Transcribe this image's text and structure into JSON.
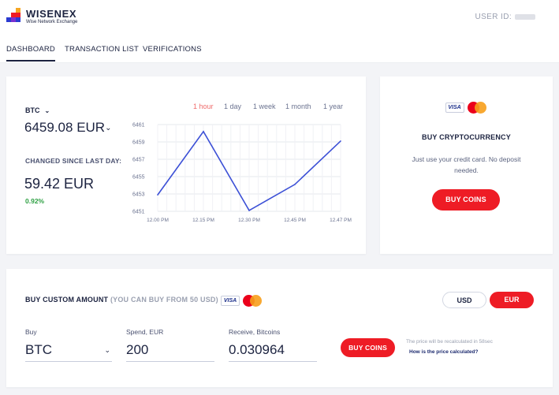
{
  "app": {
    "brand": "WISENEX",
    "brand_sub": "Wise Network Exchange",
    "user_label": "USER ID:"
  },
  "nav": {
    "tabs": [
      {
        "label": "DASHBOARD",
        "active": true
      },
      {
        "label": "TRANSACTION LIST",
        "active": false
      },
      {
        "label": "VERIFICATIONS",
        "active": false
      }
    ]
  },
  "dashboard": {
    "coin": "BTC",
    "price": "6459.08",
    "price_currency": "EUR",
    "changed_label": "CHANGED SINCE LAST DAY:",
    "change_value": "59.42 EUR",
    "change_pct": "0.92%",
    "ranges": [
      {
        "label": "1 hour",
        "active": true
      },
      {
        "label": "1 day",
        "active": false
      },
      {
        "label": "1 week",
        "active": false
      },
      {
        "label": "1 month",
        "active": false
      },
      {
        "label": "1 year",
        "active": false
      }
    ]
  },
  "chart_data": {
    "type": "line",
    "categories": [
      "12.00 PM",
      "12.15 PM",
      "12.30 PM",
      "12.45 PM",
      "12.47 PM"
    ],
    "series": [
      {
        "values": [
          6452.9,
          6460.2,
          6451.1,
          6454.1,
          6459.1
        ]
      }
    ],
    "y_ticks": [
      6461,
      6459,
      6457,
      6455,
      6453,
      6451
    ],
    "ylim": [
      6451,
      6461
    ],
    "grid": true,
    "line_color": "#3c50d6"
  },
  "buy_card": {
    "visa": "VISA",
    "title": "BUY CRYPTOCURRENCY",
    "description": "Just use your credit card. No deposit needed.",
    "button": "BUY COINS"
  },
  "custom": {
    "title": "BUY CUSTOM AMOUNT",
    "subtitle": "(YOU CAN BUY FROM 50 USD)",
    "visa": "VISA",
    "currency_options": [
      {
        "label": "USD",
        "active": false
      },
      {
        "label": "EUR",
        "active": true
      }
    ],
    "buy_label": "Buy",
    "buy_value": "BTC",
    "spend_label": "Spend, EUR",
    "spend_value": "200",
    "receive_label": "Receive, Bitcoins",
    "receive_value": "0.030964",
    "button": "BUY COINS",
    "recalc_note": "The price will be recalculated in 58sec",
    "how_link": "How is the price calculated?"
  },
  "colors": {
    "accent_red": "#ee1c25",
    "positive_green": "#2ea043",
    "navy": "#1c2340",
    "active_range": "#ef6b6b"
  },
  "icons": [
    "logo-icon",
    "chevron-down-icon",
    "visa-icon",
    "mastercard-icon"
  ]
}
